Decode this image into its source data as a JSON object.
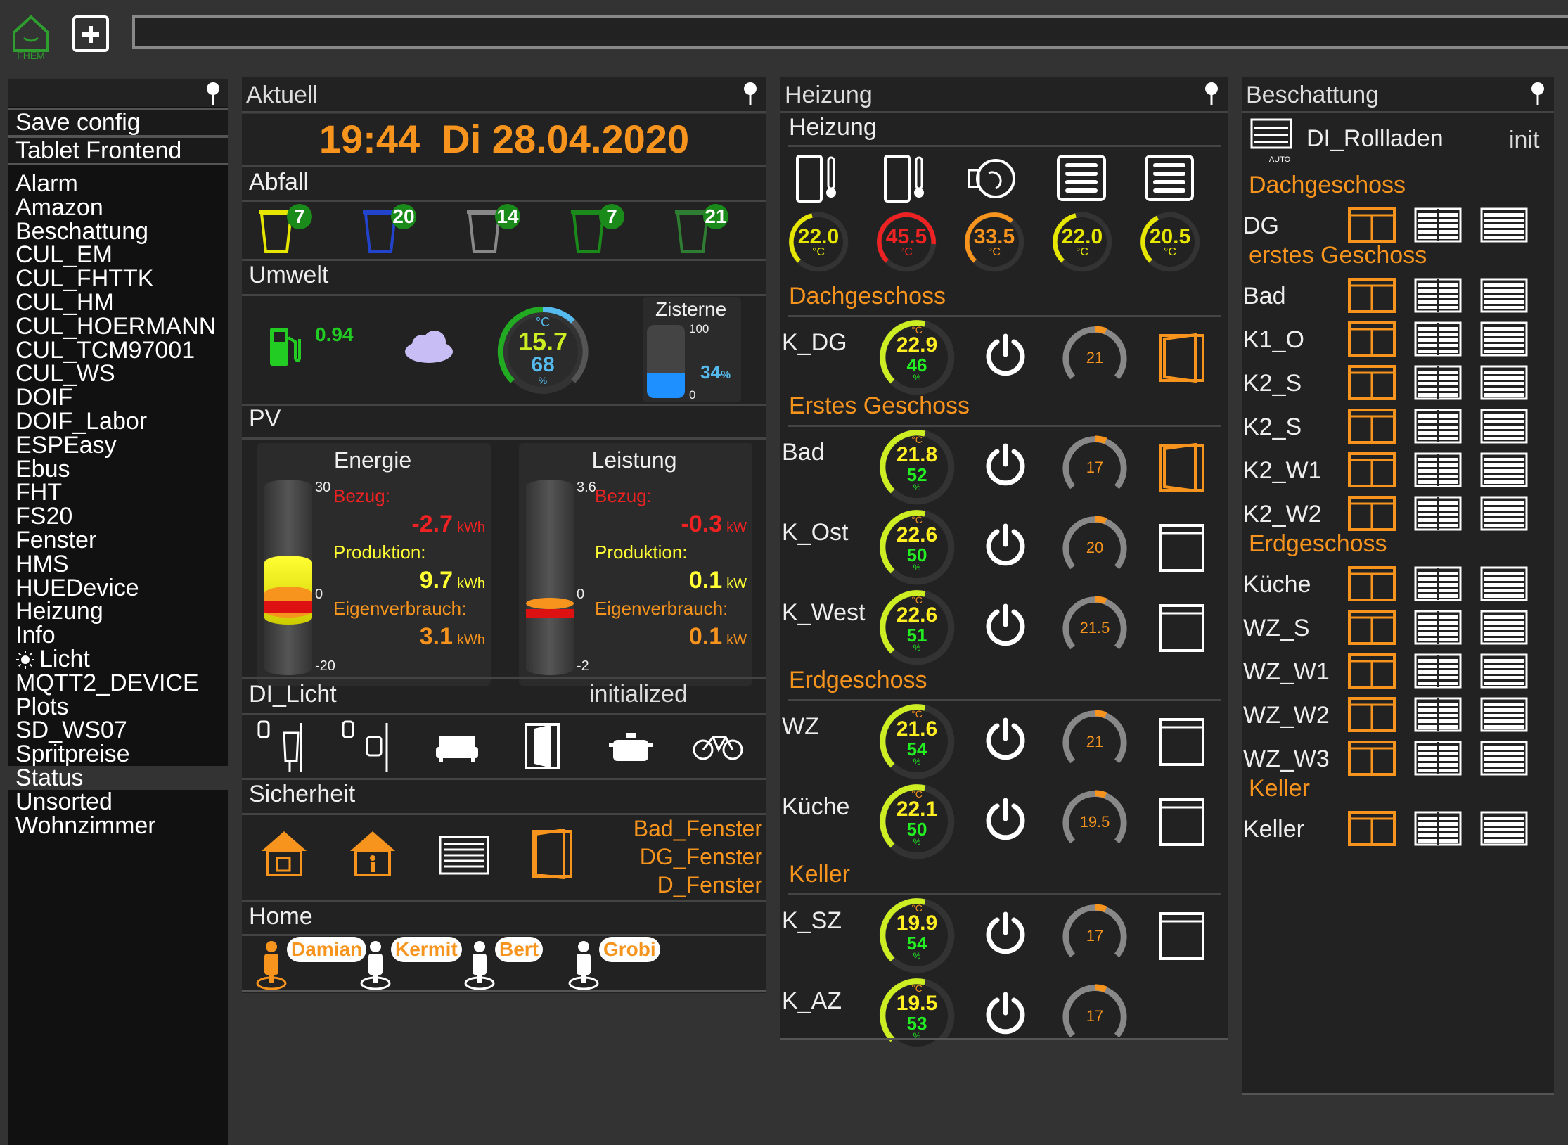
{
  "app": {
    "logo_text": "FHEM",
    "command_placeholder": ""
  },
  "sidebar": {
    "top_items": [
      {
        "label": "Save config"
      },
      {
        "label": "Tablet Frontend"
      }
    ],
    "items": [
      {
        "label": "Alarm"
      },
      {
        "label": "Amazon"
      },
      {
        "label": "Beschattung"
      },
      {
        "label": "CUL_EM"
      },
      {
        "label": "CUL_FHTTK"
      },
      {
        "label": "CUL_HM"
      },
      {
        "label": "CUL_HOERMANN"
      },
      {
        "label": "CUL_TCM97001"
      },
      {
        "label": "CUL_WS"
      },
      {
        "label": "DOIF"
      },
      {
        "label": "DOIF_Labor"
      },
      {
        "label": "ESPEasy"
      },
      {
        "label": "Ebus"
      },
      {
        "label": "FHT"
      },
      {
        "label": "FS20"
      },
      {
        "label": "Fenster"
      },
      {
        "label": "HMS"
      },
      {
        "label": "HUEDevice"
      },
      {
        "label": "Heizung"
      },
      {
        "label": "Info"
      },
      {
        "label": "Licht",
        "icon": "light-bulb-icon"
      },
      {
        "label": "MQTT2_DEVICE"
      },
      {
        "label": "Plots"
      },
      {
        "label": "SD_WS07"
      },
      {
        "label": "Spritpreise"
      },
      {
        "label": "Status",
        "active": true
      },
      {
        "label": "Unsorted"
      },
      {
        "label": "Wohnzimmer"
      }
    ]
  },
  "aktuell": {
    "title": "Aktuell",
    "time": "19:44",
    "date": "Di 28.04.2020",
    "abfall": {
      "title": "Abfall",
      "bins": [
        {
          "color": "#e6e600",
          "days": "7"
        },
        {
          "color": "#2244cc",
          "days": "20"
        },
        {
          "color": "#888888",
          "days": "14"
        },
        {
          "color": "#1a8a1a",
          "days": "7"
        },
        {
          "color": "#2e7d32",
          "days": "21"
        }
      ]
    },
    "umwelt": {
      "title": "Umwelt",
      "fuel_value": "0.94",
      "temp": "15.7",
      "temp_unit": "°C",
      "humidity": "68",
      "humidity_unit": "%",
      "zisterne_title": "Zisterne",
      "zisterne_max": "100",
      "zisterne_min": "0",
      "zisterne_value": "34",
      "zisterne_unit": "%"
    },
    "pv": {
      "title": "PV",
      "energie": {
        "title": "Energie",
        "max": "30",
        "zero": "0",
        "min": "-20",
        "bezug_label": "Bezug:",
        "bezug_value": "-2.7",
        "produktion_label": "Produktion:",
        "produktion_value": "9.7",
        "eigen_label": "Eigenverbrauch:",
        "eigen_value": "3.1",
        "unit": "kWh"
      },
      "leistung": {
        "title": "Leistung",
        "max": "3.6",
        "zero": "0",
        "min": "-2",
        "bezug_label": "Bezug:",
        "bezug_value": "-0.3",
        "produktion_label": "Produktion:",
        "produktion_value": "0.1",
        "eigen_label": "Eigenverbrauch:",
        "eigen_value": "0.1",
        "unit": "kW"
      }
    },
    "licht": {
      "title": "DI_Licht",
      "status": "initialized"
    },
    "sicherheit": {
      "title": "Sicherheit",
      "open_windows": [
        "Bad_Fenster",
        "DG_Fenster",
        "D_Fenster"
      ]
    },
    "home": {
      "title": "Home",
      "persons": [
        {
          "name": "Damian",
          "present": true
        },
        {
          "name": "Kermit",
          "present": false
        },
        {
          "name": "Bert",
          "present": false
        },
        {
          "name": "Grobi",
          "present": false
        }
      ]
    }
  },
  "heizung": {
    "title": "Heizung",
    "subtitle": "Heizung",
    "top_gauges": [
      {
        "value": "22.0",
        "unit": "°C",
        "color": "#e6e600"
      },
      {
        "value": "45.5",
        "unit": "°C",
        "color": "#ee2222"
      },
      {
        "value": "33.5",
        "unit": "°C",
        "color": "#f7941d"
      },
      {
        "value": "22.0",
        "unit": "°C",
        "color": "#e6e600"
      },
      {
        "value": "20.5",
        "unit": "°C",
        "color": "#e6e600"
      }
    ],
    "sections": [
      {
        "title": "Dachgeschoss",
        "rooms": [
          {
            "name": "K_DG",
            "temp": "22.9",
            "hum": "46",
            "set": "21",
            "window": "open"
          }
        ]
      },
      {
        "title": "Erstes Geschoss",
        "rooms": [
          {
            "name": "Bad",
            "temp": "21.8",
            "hum": "52",
            "set": "17",
            "window": "open"
          },
          {
            "name": "K_Ost",
            "temp": "22.6",
            "hum": "50",
            "set": "20",
            "window": "closed"
          },
          {
            "name": "K_West",
            "temp": "22.6",
            "hum": "51",
            "set": "21.5",
            "window": "closed"
          }
        ]
      },
      {
        "title": "Erdgeschoss",
        "rooms": [
          {
            "name": "WZ",
            "temp": "21.6",
            "hum": "54",
            "set": "21",
            "window": "closed"
          },
          {
            "name": "Küche",
            "temp": "22.1",
            "hum": "50",
            "set": "19.5",
            "window": "closed"
          }
        ]
      },
      {
        "title": "Keller",
        "rooms": [
          {
            "name": "K_SZ",
            "temp": "19.9",
            "hum": "54",
            "set": "17",
            "window": "closed"
          },
          {
            "name": "K_AZ",
            "temp": "19.5",
            "hum": "53",
            "set": "17",
            "window": "none"
          }
        ]
      }
    ]
  },
  "beschattung": {
    "title": "Beschattung",
    "device": "DI_Rollladen",
    "device_status": "init",
    "auto_label": "AUTO",
    "sections": [
      {
        "title": "Dachgeschoss",
        "rooms": [
          "DG"
        ]
      },
      {
        "title": "erstes Geschoss",
        "rooms": [
          "Bad",
          "K1_O",
          "K2_S",
          "K2_S",
          "K2_W1",
          "K2_W2"
        ]
      },
      {
        "title": "Erdgeschoss",
        "rooms": [
          "Küche",
          "WZ_S",
          "WZ_W1",
          "WZ_W2",
          "WZ_W3"
        ]
      },
      {
        "title": "Keller",
        "rooms": [
          "Keller"
        ]
      }
    ]
  },
  "colors": {
    "accent": "#f7941d",
    "green": "#1a8a1a",
    "panel": "#222222"
  }
}
